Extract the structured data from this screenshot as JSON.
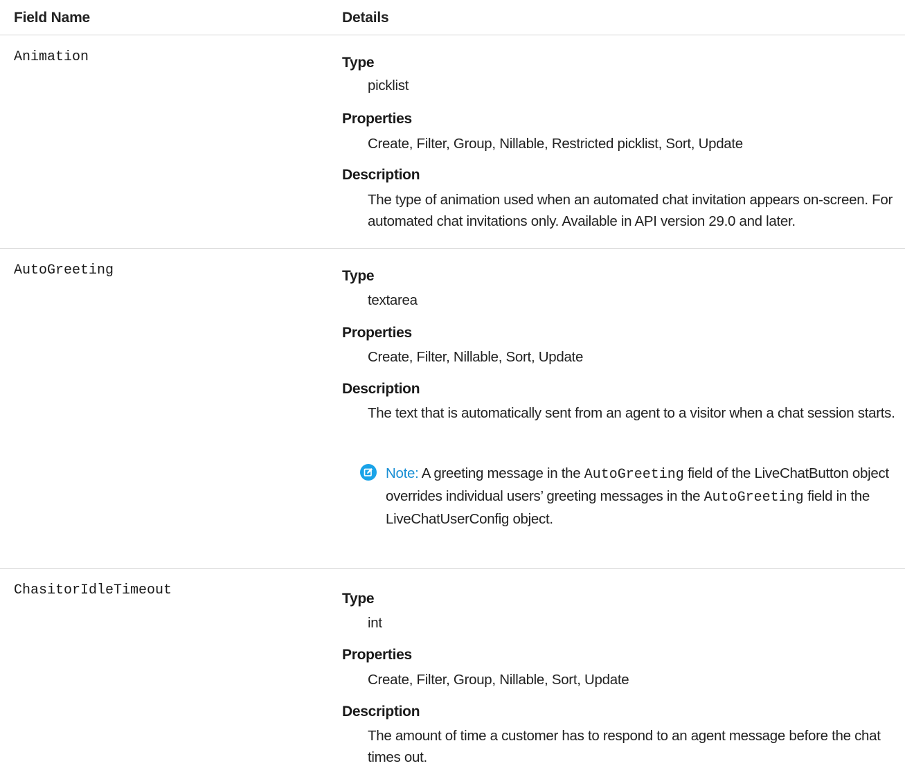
{
  "header": {
    "field_name": "Field Name",
    "details": "Details"
  },
  "fields": [
    {
      "name": "Animation",
      "type_label": "Type",
      "type": "picklist",
      "properties_label": "Properties",
      "properties": "Create, Filter, Group, Nillable, Restricted picklist, Sort, Update",
      "description_label": "Description",
      "description": "The type of animation used when an automated chat invitation appears on-screen. For automated chat invitations only. Available in API version 29.0 and later."
    },
    {
      "name": "AutoGreeting",
      "type_label": "Type",
      "type": "textarea",
      "properties_label": "Properties",
      "properties": "Create, Filter, Nillable, Sort, Update",
      "description_label": "Description",
      "description": "The text that is automatically sent from an agent to a visitor when a chat session starts.",
      "note": {
        "label": "Note:",
        "text_1": "A greeting message in the",
        "code_1": "AutoGreeting",
        "text_2": "field of the LiveChatButton object overrides individual users’ greeting messages in the",
        "code_2": "AutoGreeting",
        "text_3": "field in the LiveChatUserConfig object."
      }
    },
    {
      "name": "ChasitorIdleTimeout",
      "type_label": "Type",
      "type": "int",
      "properties_label": "Properties",
      "properties": "Create, Filter, Group, Nillable, Sort, Update",
      "description_label": "Description",
      "description": "The amount of time a customer has to respond to an agent message before the chat times out."
    }
  ],
  "colors": {
    "note_icon": "#1aa3e8",
    "note_label": "#1a8fd4",
    "divider": "#d4d4d4"
  },
  "icons": {
    "note": "edit-note-icon"
  }
}
